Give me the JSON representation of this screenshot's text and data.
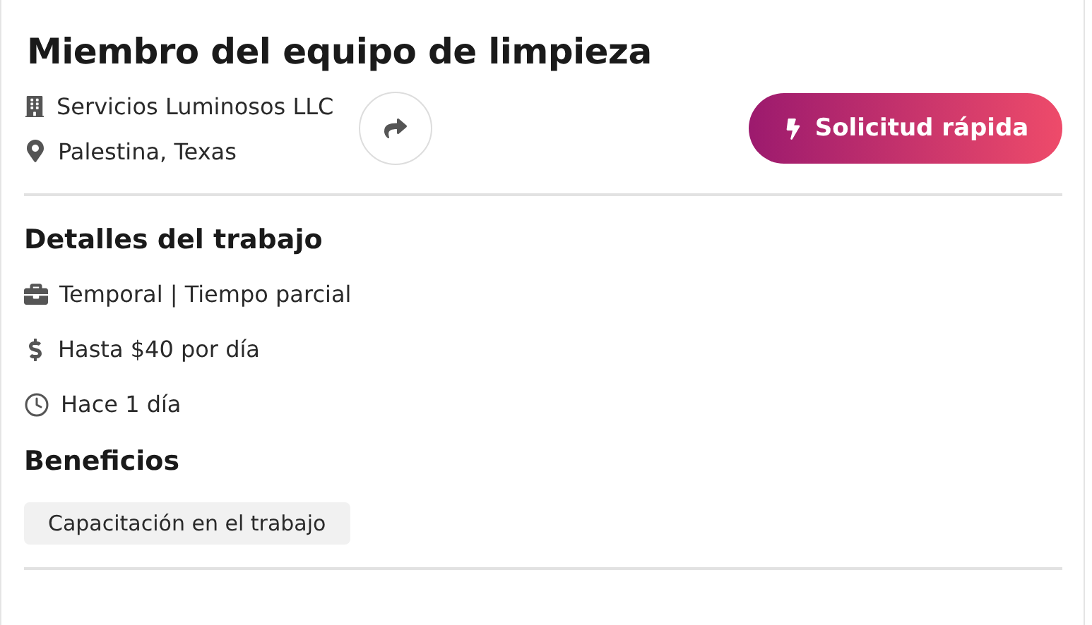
{
  "job": {
    "title": "Miembro del equipo de limpieza",
    "company": "Servicios Luminosos LLC",
    "location": "Palestina, Texas"
  },
  "actions": {
    "apply_label": "Solicitud rápida"
  },
  "details": {
    "heading": "Detalles del trabajo",
    "items": [
      {
        "kind": "type",
        "text": "Temporal | Tiempo parcial"
      },
      {
        "kind": "pay",
        "text": "Hasta $40 por día"
      },
      {
        "kind": "posted",
        "text": "Hace 1 día"
      }
    ]
  },
  "benefits": {
    "heading": "Beneficios",
    "items": [
      "Capacitación en el trabajo"
    ]
  }
}
